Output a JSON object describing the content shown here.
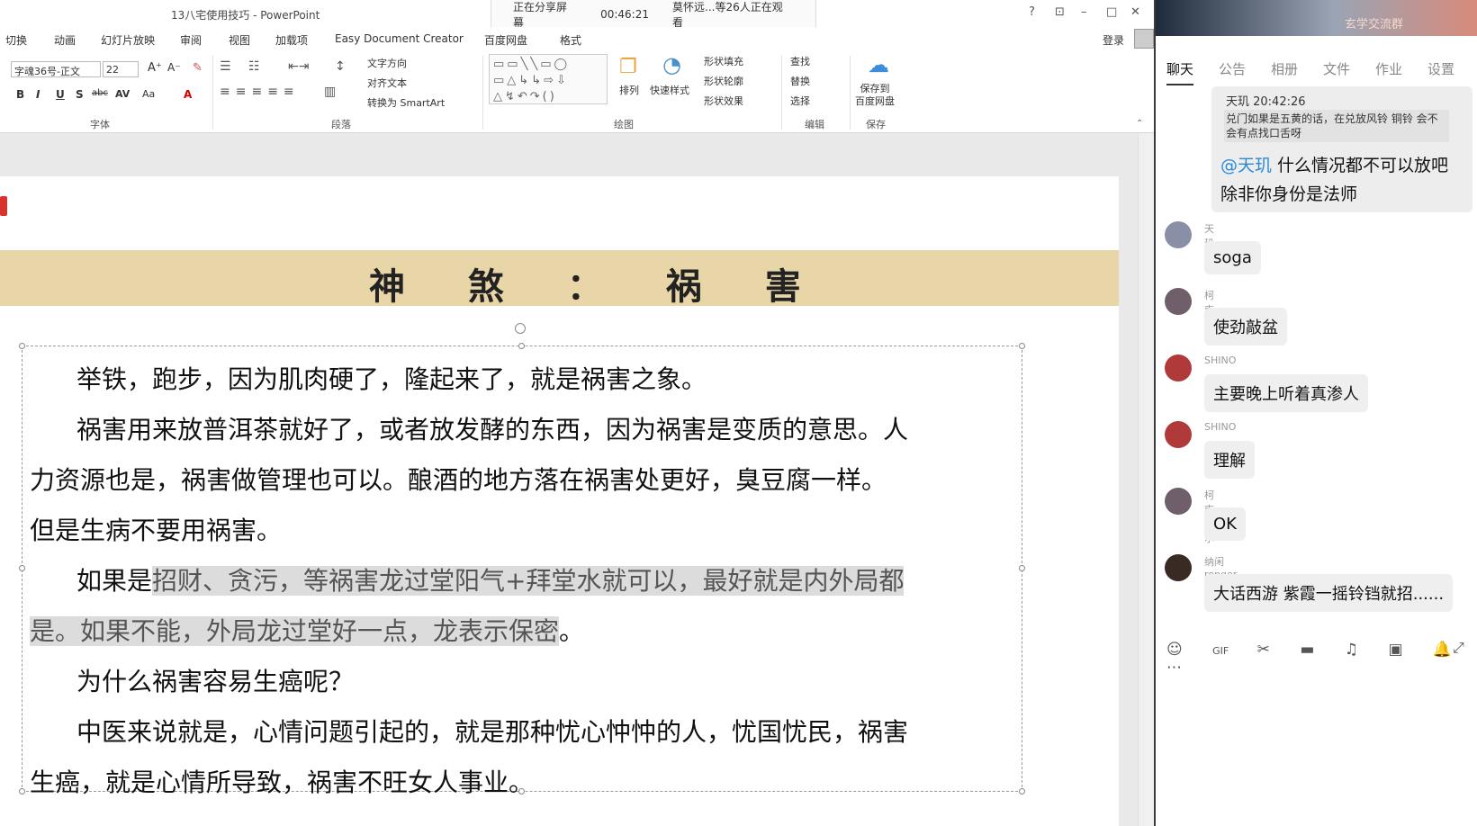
{
  "window": {
    "title": "13八宅使用技巧 - PowerPoint",
    "help": "?",
    "controls": [
      "⊡",
      "–",
      "□",
      "✕"
    ]
  },
  "share_bar": {
    "status": "正在分享屏幕",
    "elapsed": "00:46:21",
    "viewers": "莫怀远...等26人正在观看"
  },
  "menu": {
    "items": [
      "切换",
      "动画",
      "幻灯片放映",
      "审阅",
      "视图",
      "加载项",
      "Easy Document Creator",
      "百度网盘",
      "格式"
    ],
    "login": "登录"
  },
  "ribbon": {
    "font_name": "字魂36号-正文",
    "font_size": "22",
    "groups": [
      "字体",
      "段落",
      "绘图",
      "编辑",
      "保存"
    ],
    "text_direction": "文字方向",
    "align_text": "对齐文本",
    "smartart": "转换为 SmartArt",
    "arrange": "排列",
    "quick_styles": "快速样式",
    "shape_fill": "形状填充",
    "shape_outline": "形状轮廓",
    "shape_effect": "形状效果",
    "find": "查找",
    "replace": "替换",
    "select": "选择",
    "save_baidu": "保存到\n百度网盘"
  },
  "slide": {
    "heading": "神 煞 ： 祸 害",
    "p1": "举铁，跑步，因为肌肉硬了，隆起来了，就是祸害之象。",
    "p2a": "祸害用来放普洱茶就好了，或者放发酵的东西，因为祸害是变质的意思。人",
    "p2b": "力资源也是，祸害做管理也可以。酿酒的地方落在祸害处更好，臭豆腐一样。",
    "p2c": "但是生病不要用祸害。",
    "p3_pre": "如果是",
    "p3_hl": "招财、贪污，等祸害龙过堂阳气+拜堂水就可以，最好就是内外局都",
    "p3b_hl": "是。如果不能，外局龙过堂好一点，龙表示保密",
    "p3b_post": "。",
    "p4": "为什么祸害容易生癌呢？",
    "p5a": "中医来说就是，心情问题引起的，就是那种忧心忡忡的人，忧国忧民，祸害",
    "p5b": "生癌，就是心情所导致，祸害不旺女人事业。"
  },
  "chat": {
    "group_title": "玄学交流群",
    "tabs": [
      "聊天",
      "公告",
      "相册",
      "文件",
      "作业",
      "设置"
    ],
    "quote_header": "天玑  20:42:26",
    "quote_body": "兑门如果是五黄的话，在兑放风铃 铜铃 会不会有点找口舌呀",
    "quote_mention": "@天玑",
    "quote_reply": " 什么情况都不可以放吧 除非你身份是法师",
    "messages": [
      {
        "name": "天玑",
        "text": "soga"
      },
      {
        "name": "柯南道尔",
        "text": "使劲敲盆"
      },
      {
        "name": "SHINO",
        "text": "主要晚上听着真渗人"
      },
      {
        "name": "SHINO",
        "text": "理解"
      },
      {
        "name": "柯南道尔",
        "text": "OK"
      },
      {
        "name": "纳闲ronger",
        "text": "大话西游 紫霞一摇铃铛就招......"
      }
    ],
    "toolbar_icons": [
      "☺",
      "GIF",
      "✂",
      "▬",
      "♫",
      "▣",
      "🔔",
      "⋯"
    ]
  }
}
